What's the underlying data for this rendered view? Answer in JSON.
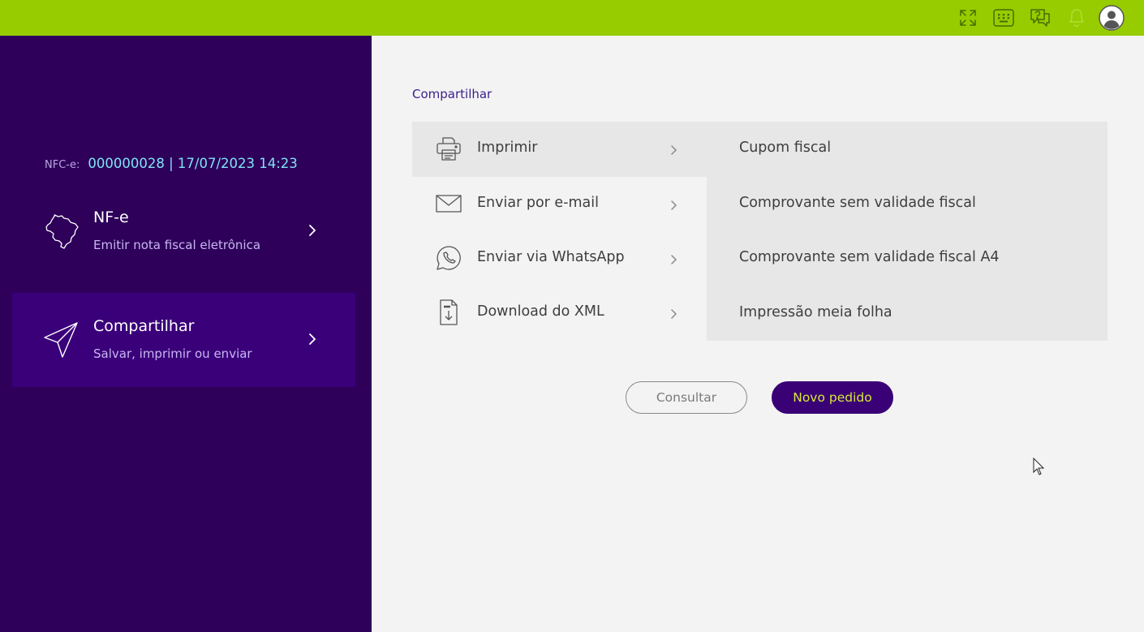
{
  "topbar": {
    "color": "#97cc00",
    "icons": [
      "fullscreen-icon",
      "keypad-icon",
      "help-chat-icon",
      "bell-icon",
      "user-avatar-icon"
    ]
  },
  "sidebar": {
    "nfce_label": "NFC-e:",
    "nfce_value": "000000028 | 17/07/2023 14:23",
    "items": [
      {
        "title": "NF-e",
        "subtitle": "Emitir nota fiscal eletrônica",
        "icon": "brazil-map-icon"
      },
      {
        "title": "Compartilhar",
        "subtitle": "Salvar, imprimir ou enviar",
        "icon": "send-icon",
        "active": true
      }
    ]
  },
  "main": {
    "breadcrumb": "Compartilhar",
    "options": [
      {
        "label": "Imprimir",
        "icon": "printer-icon",
        "active": true
      },
      {
        "label": "Enviar por e-mail",
        "icon": "mail-icon"
      },
      {
        "label": "Enviar via WhatsApp",
        "icon": "whatsapp-icon"
      },
      {
        "label": "Download do XML",
        "icon": "xml-download-icon"
      }
    ],
    "sub_options": [
      "Cupom fiscal",
      "Comprovante sem validade fiscal",
      "Comprovante sem validade fiscal A4",
      "Impressão meia folha"
    ],
    "buttons": {
      "consultar": "Consultar",
      "novo_pedido": "Novo pedido"
    }
  },
  "colors": {
    "sidebar_bg": "#2e005a",
    "sidebar_active": "#3a007a",
    "accent_green": "#97cc00",
    "primary_button": "#3a0075",
    "primary_button_text": "#d6e83a"
  }
}
